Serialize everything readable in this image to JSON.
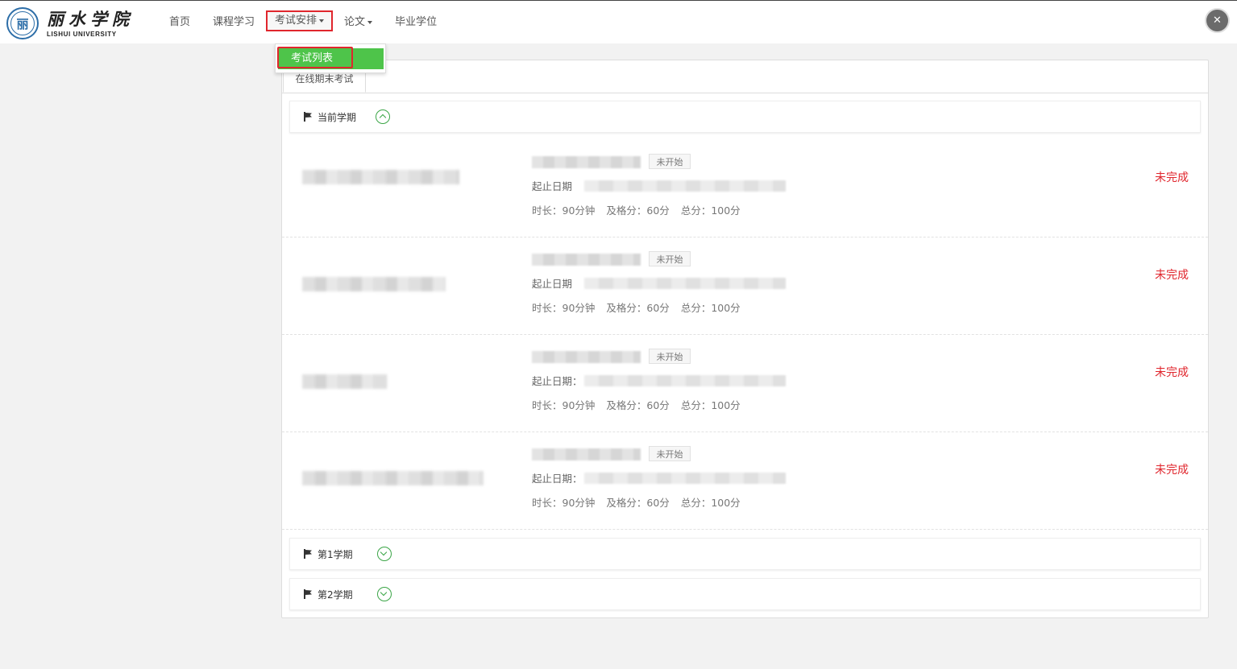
{
  "header": {
    "logo_glyph": "丽",
    "logo_cn": "丽水学院",
    "logo_en": "LISHUI UNIVERSITY",
    "nav": [
      {
        "label": "首页"
      },
      {
        "label": "课程学习"
      },
      {
        "label": "考试安排"
      },
      {
        "label": "论文"
      },
      {
        "label": "毕业学位"
      }
    ],
    "dropdown": {
      "item": "考试列表"
    }
  },
  "tabs": [
    {
      "label": "在线期末考试"
    }
  ],
  "terms": [
    {
      "title": "当前学期",
      "expanded": true
    },
    {
      "title": "第1学期",
      "expanded": false
    },
    {
      "title": "第2学期",
      "expanded": false
    }
  ],
  "exams": [
    {
      "status": "未开始",
      "date_label": "起止日期",
      "duration": "时长：90分钟",
      "pass": "及格分：60分",
      "total": "总分：100分",
      "result": "未完成"
    },
    {
      "status": "未开始",
      "date_label": "起止日期",
      "duration": "时长：90分钟",
      "pass": "及格分：60分",
      "total": "总分：100分",
      "result": "未完成"
    },
    {
      "status": "未开始",
      "date_label": "起止日期：",
      "duration": "时长：90分钟",
      "pass": "及格分：60分",
      "total": "总分：100分",
      "result": "未完成"
    },
    {
      "status": "未开始",
      "date_label": "起止日期：",
      "duration": "时长：90分钟",
      "pass": "及格分：60分",
      "total": "总分：100分",
      "result": "未完成"
    }
  ],
  "colors": {
    "accent_green": "#4ec44a",
    "highlight_red": "#e0262d"
  }
}
